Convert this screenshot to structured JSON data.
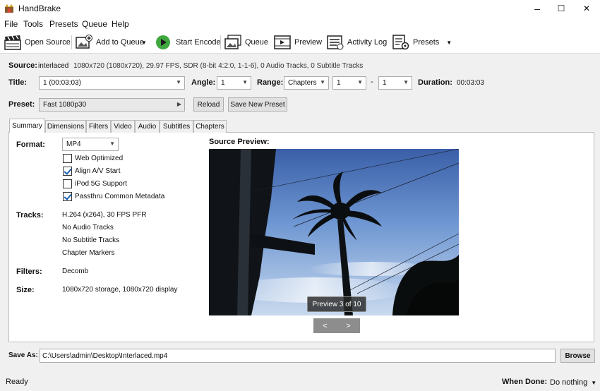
{
  "window": {
    "title": "HandBrake",
    "minimize": "–",
    "maximize": "☐",
    "close": "✕"
  },
  "menu": [
    "File",
    "Tools",
    "Presets",
    "Queue",
    "Help"
  ],
  "toolbar": {
    "open_source": "Open Source",
    "add_to_queue": "Add to Queue",
    "start_encode": "Start Encode",
    "queue": "Queue",
    "preview": "Preview",
    "activity_log": "Activity Log",
    "presets": "Presets"
  },
  "source": {
    "label": "Source:",
    "name": "interlaced",
    "info": "1080x720 (1080x720), 29.97 FPS, SDR (8-bit 4:2:0, 1-1-6), 0 Audio Tracks, 0 Subtitle Tracks"
  },
  "title_row": {
    "title_label": "Title:",
    "title_value": "1  (00:03:03)",
    "angle_label": "Angle:",
    "angle_value": "1",
    "range_label": "Range:",
    "range_type": "Chapters",
    "range_start": "1",
    "range_dash": "-",
    "range_end": "1",
    "duration_label": "Duration:",
    "duration_value": "00:03:03"
  },
  "preset_row": {
    "label": "Preset:",
    "value": "Fast 1080p30",
    "reload": "Reload",
    "save_new": "Save New Preset"
  },
  "tabs": [
    "Summary",
    "Dimensions",
    "Filters",
    "Video",
    "Audio",
    "Subtitles",
    "Chapters"
  ],
  "active_tab": "Summary",
  "summary": {
    "format_label": "Format:",
    "format_value": "MP4",
    "options": [
      {
        "label": "Web Optimized",
        "checked": false
      },
      {
        "label": "Align A/V Start",
        "checked": true
      },
      {
        "label": "iPod 5G Support",
        "checked": false
      },
      {
        "label": "Passthru Common Metadata",
        "checked": true
      }
    ],
    "tracks_label": "Tracks:",
    "tracks": [
      "H.264 (x264), 30 FPS PFR",
      "No Audio Tracks",
      "No Subtitle Tracks",
      "Chapter Markers"
    ],
    "filters_label": "Filters:",
    "filters_value": "Decomb",
    "size_label": "Size:",
    "size_value": "1080x720 storage, 1080x720 display",
    "preview_label": "Source Preview:",
    "preview_badge": "Preview 3 of 10",
    "prev_btn": "<",
    "next_btn": ">"
  },
  "save_as": {
    "label": "Save As:",
    "path": "C:\\Users\\admin\\Desktop\\Interlaced.mp4",
    "browse": "Browse"
  },
  "status": {
    "text": "Ready",
    "when_done_label": "When Done:",
    "when_done_value": "Do nothing"
  },
  "colors": {
    "accent": "#1a5fb4",
    "start_green": "#3ea83e",
    "window_bg": "#f0f0f0"
  }
}
